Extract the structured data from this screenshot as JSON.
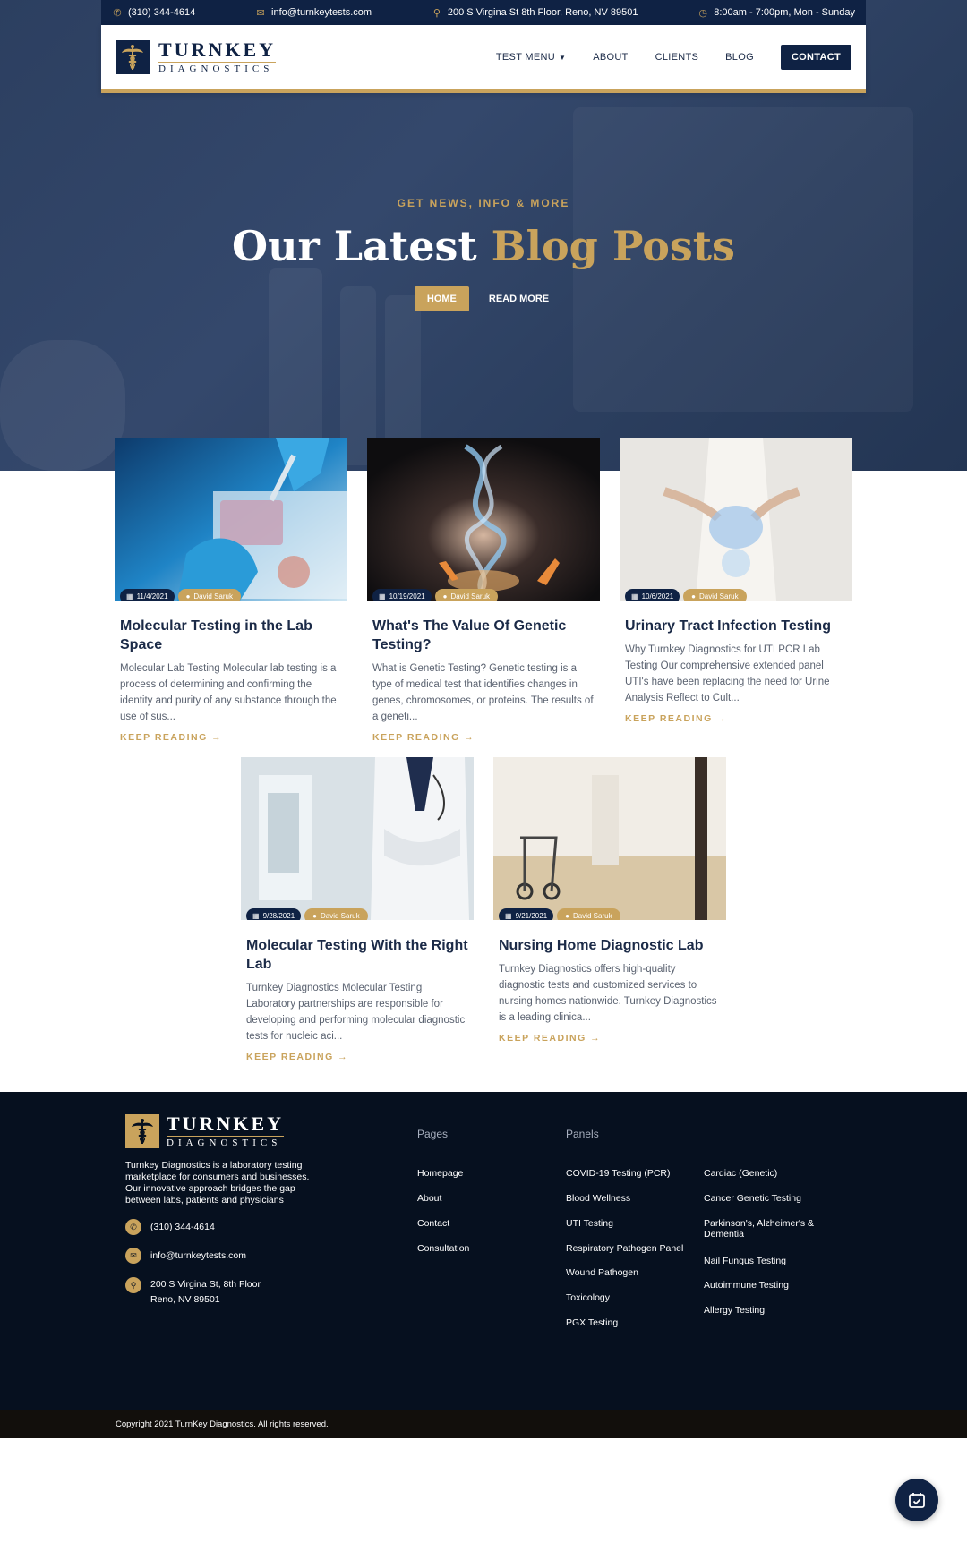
{
  "topbar": {
    "phone": "(310) 344-4614",
    "email": "info@turnkeytests.com",
    "address": "200 S Virgina St 8th Floor, Reno, NV 89501",
    "hours": "8:00am - 7:00pm, Mon - Sunday"
  },
  "brand": {
    "name_line1": "TURNKEY",
    "name_line2": "DIAGNOSTICS"
  },
  "nav": {
    "test_menu": "TEST MENU",
    "about": "ABOUT",
    "clients": "CLIENTS",
    "blog": "BLOG",
    "contact": "CONTACT"
  },
  "hero": {
    "kicker": "GET NEWS, INFO & MORE",
    "title_plain": "Our Latest",
    "title_accent": "Blog Posts",
    "btn_home": "HOME",
    "btn_read": "READ MORE"
  },
  "posts": [
    {
      "date": "11/4/2021",
      "author": "David Saruk",
      "title": "Molecular Testing in the Lab Space",
      "excerpt": "Molecular Lab Testing Molecular lab testing is a process of determining and confirming the identity and purity of any substance through the use of sus...",
      "more": "KEEP READING →"
    },
    {
      "date": "10/19/2021",
      "author": "David Saruk",
      "title": "What's The Value Of Genetic Testing?",
      "excerpt": "What is Genetic Testing? Genetic testing is a type of medical test that identifies changes in genes, chromosomes, or proteins. The results of a geneti...",
      "more": "KEEP READING →"
    },
    {
      "date": "10/6/2021",
      "author": "David Saruk",
      "title": "Urinary Tract Infection Testing",
      "excerpt": "Why Turnkey Diagnostics for UTI PCR Lab Testing Our comprehensive extended panel UTI's have been replacing the need for Urine Analysis Reflect to Cult...",
      "more": "KEEP READING →"
    },
    {
      "date": "9/28/2021",
      "author": "David Saruk",
      "title": "Molecular Testing With the Right Lab",
      "excerpt": "Turnkey Diagnostics Molecular Testing Laboratory partnerships are responsible for developing and performing molecular diagnostic tests for nucleic aci...",
      "more": "KEEP READING →"
    },
    {
      "date": "9/21/2021",
      "author": "David Saruk",
      "title": "Nursing Home Diagnostic Lab",
      "excerpt": "Turnkey Diagnostics offers high-quality diagnostic tests and customized services to nursing homes nationwide. Turnkey Diagnostics is a leading clinica...",
      "more": "KEEP READING →"
    }
  ],
  "footer": {
    "description": "Turnkey Diagnostics is a laboratory testing marketplace for consumers and businesses. Our innovative approach bridges the gap between labs, patients and physicians",
    "phone": "(310) 344-4614",
    "email": "info@turnkeytests.com",
    "address_line1": "200 S Virgina St, 8th Floor",
    "address_line2": "Reno, NV 89501",
    "pages_title": "Pages",
    "pages": [
      "Homepage",
      "About",
      "Contact",
      "Consultation"
    ],
    "panels_title": "Panels",
    "panels_col1": [
      "COVID-19 Testing (PCR)",
      "Blood Wellness",
      "UTI Testing",
      "Respiratory Pathogen Panel",
      "Wound Pathogen",
      "Toxicology",
      "PGX Testing"
    ],
    "panels_col2": [
      "Cardiac (Genetic)",
      "Cancer Genetic Testing",
      "Parkinson's, Alzheimer's & Dementia",
      "Nail Fungus Testing",
      "Autoimmune Testing",
      "Allergy Testing"
    ],
    "copyright": "Copyright 2021 TurnKey Diagnostics. All rights reserved."
  },
  "colors": {
    "navy": "#0f2244",
    "gold": "#c9a35c",
    "footer_bg": "#06101f"
  }
}
